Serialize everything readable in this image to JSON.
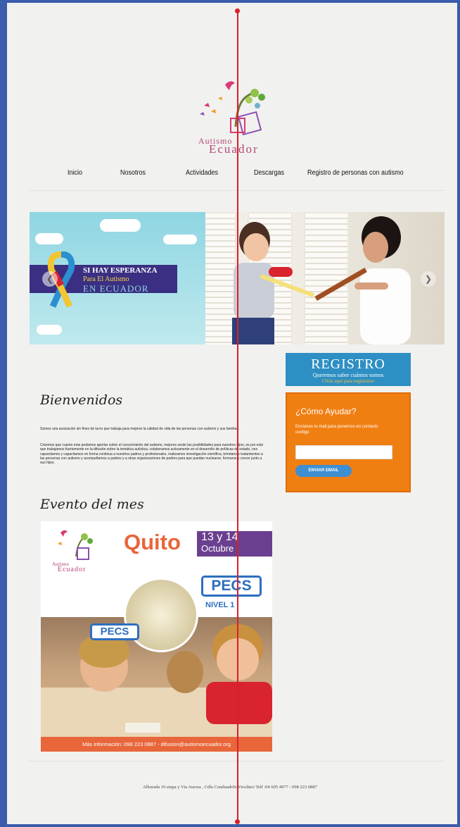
{
  "site": {
    "logo_line1": "Autismo",
    "logo_line2": "Ecuador"
  },
  "nav": {
    "items": [
      "Inicio",
      "Nosotros",
      "Actividades",
      "Descargas",
      "Registro de personas con autismo"
    ]
  },
  "hero": {
    "line1": "SI HAY ESPERANZA",
    "line2": "Para El Autismo",
    "line3": "EN ECUADOR",
    "prev_icon": "chevron-left-icon",
    "next_icon": "chevron-right-icon"
  },
  "registro": {
    "title": "REGISTRO",
    "subtitle": "Queremos saber cuántos somos",
    "cta": "Click aquí para registrarse"
  },
  "ayudar": {
    "title": "¿Cómo Ayudar?",
    "text": "Envíanos tu mail para ponernos en contacto contigo",
    "input_value": "",
    "button": "ENVIAR EMAIL"
  },
  "main": {
    "welcome_heading": "Bienvenidos",
    "intro_p1": "Somos una asociación sin fines de lucro que trabaja para mejorar la calidad de vida de las personas con autismo y sus familias.",
    "intro_p2": "Creemos que cuanto más podamos aportar sobre el conocimiento del autismo, mejores serán las posibilidades para nuestros hijos, es por esto que trabajamos fuertemente en la difusión sobre la temática autística, colaboramos activamente en el desarrollo de políticas de estado, nos capacitamos y capacitamos en forma continua a nuestros padres y profesionales, realizamos investigación científica, brindamos tratamientos a las personas con autismo y acompañamos a padres y a otras organizaciones de padres para que puedan nuclearse, formarse y crecer junto a sus hijos.",
    "event_heading": "Evento del mes"
  },
  "poster": {
    "logo_line1": "Autismo",
    "logo_line2": "Ecuador",
    "city": "Quito",
    "date_line1": "13 y 14",
    "date_line2": "Octubre",
    "pecs": "PECS",
    "level": "NIVEL 1",
    "footer": "Más información: 098 223 0887 - difusion@autismoecuador.org"
  },
  "footer": {
    "address": "Alborada 10 etapa y Via Aurora , Cdla Conduadrile Vicolinci Telf :04 605 4977 - 098 223 0887"
  },
  "colors": {
    "frame": "#3b5bab",
    "accent_orange": "#f07f12",
    "registro_blue": "#2d8fc3",
    "brand_purple": "#3a2f82"
  }
}
